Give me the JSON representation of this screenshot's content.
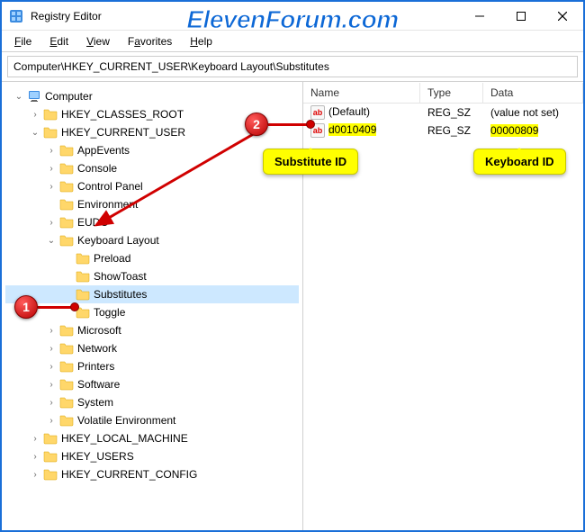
{
  "window": {
    "title": "Registry Editor",
    "watermark": "ElevenForum.com"
  },
  "menubar": {
    "file": "File",
    "edit": "Edit",
    "view": "View",
    "favorites": "Favorites",
    "help": "Help"
  },
  "address": "Computer\\HKEY_CURRENT_USER\\Keyboard Layout\\Substitutes",
  "tree": {
    "root": "Computer",
    "hkcr": "HKEY_CLASSES_ROOT",
    "hkcu": "HKEY_CURRENT_USER",
    "appevents": "AppEvents",
    "console": "Console",
    "controlpanel": "Control Panel",
    "environment": "Environment",
    "eudc": "EUDC",
    "keyboardlayout": "Keyboard Layout",
    "preload": "Preload",
    "showtoast": "ShowToast",
    "substitutes": "Substitutes",
    "toggle": "Toggle",
    "microsoft": "Microsoft",
    "network": "Network",
    "printers": "Printers",
    "software": "Software",
    "system": "System",
    "volatile": "Volatile Environment",
    "hklm": "HKEY_LOCAL_MACHINE",
    "hku": "HKEY_USERS",
    "hkcc": "HKEY_CURRENT_CONFIG"
  },
  "list": {
    "headers": {
      "name": "Name",
      "type": "Type",
      "data": "Data"
    },
    "rows": [
      {
        "name": "(Default)",
        "type": "REG_SZ",
        "data": "(value not set)",
        "hl_name": false,
        "hl_data": false
      },
      {
        "name": "d0010409",
        "type": "REG_SZ",
        "data": "00000809",
        "hl_name": true,
        "hl_data": true
      }
    ]
  },
  "callouts": {
    "num1": "1",
    "num2": "2",
    "balloon_sub": "Substitute ID",
    "balloon_kb": "Keyboard ID"
  }
}
